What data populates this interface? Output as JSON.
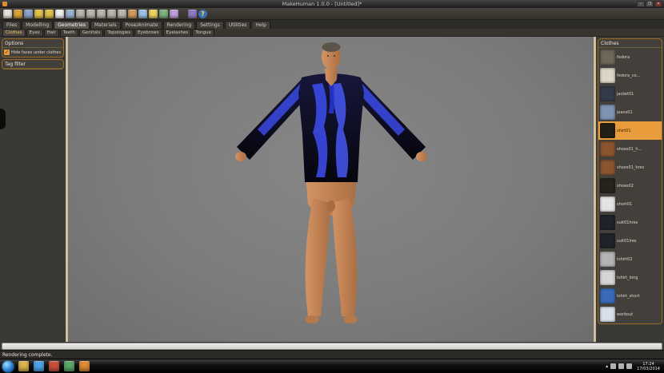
{
  "window": {
    "title": "MakeHuman 1.0.0 - [Untitled]*",
    "controls": {
      "minimize": "–",
      "maximize": "❐",
      "close": "✕"
    }
  },
  "toolbar": {
    "icons": [
      {
        "name": "new-file",
        "color": "#e6e3dd"
      },
      {
        "name": "load",
        "color": "#d8a038"
      },
      {
        "name": "save",
        "color": "#8aa0c8"
      },
      {
        "name": "undo",
        "color": "#e0c048"
      },
      {
        "name": "redo",
        "color": "#e0c048"
      },
      {
        "name": "random",
        "color": "#efefef"
      },
      {
        "name": "grid",
        "color": "#9ab0d0"
      },
      {
        "name": "front-view",
        "color": "#b8b4ae"
      },
      {
        "name": "back-view",
        "color": "#b8b4ae"
      },
      {
        "name": "left-view",
        "color": "#b8b4ae"
      },
      {
        "name": "right-view",
        "color": "#b8b4ae"
      },
      {
        "name": "top-view",
        "color": "#b8b4ae"
      },
      {
        "name": "pose",
        "color": "#cf9a62"
      },
      {
        "name": "smooth",
        "color": "#9cc0e4"
      },
      {
        "name": "light",
        "color": "#ecd25e"
      },
      {
        "name": "material",
        "color": "#7db07d"
      },
      {
        "name": "measure",
        "color": "#c0a0d8"
      },
      {
        "name": "render",
        "color": "#9078c0"
      }
    ],
    "help_glyph": "?"
  },
  "main_tabs": {
    "active": "Geometries",
    "items": [
      {
        "label": "Files"
      },
      {
        "label": "Modelling"
      },
      {
        "label": "Geometries"
      },
      {
        "label": "Materials"
      },
      {
        "label": "Pose/Animate"
      },
      {
        "label": "Rendering"
      },
      {
        "label": "Settings"
      },
      {
        "label": "Utilities"
      },
      {
        "label": "Help"
      }
    ]
  },
  "sub_tabs": {
    "active": "Clothes",
    "items": [
      {
        "label": "Clothes"
      },
      {
        "label": "Eyes"
      },
      {
        "label": "Hair"
      },
      {
        "label": "Teeth"
      },
      {
        "label": "Genitals"
      },
      {
        "label": "Topologies"
      },
      {
        "label": "Eyebrows"
      },
      {
        "label": "Eyelashes"
      },
      {
        "label": "Tongue"
      }
    ]
  },
  "left_panel": {
    "options": {
      "title": "Options",
      "checkbox_label": "Hide faces under clothes",
      "checked": true,
      "check_glyph": "✓"
    },
    "tag_filter": {
      "title": "Tag filter"
    }
  },
  "clothes_panel": {
    "title": "Clothes",
    "selected": "shirt01",
    "items": [
      {
        "label": "fedora",
        "thumb": "#6e6658"
      },
      {
        "label": "fedora_co...",
        "thumb": "#ddd6c8"
      },
      {
        "label": "jacket01",
        "thumb": "#333a4a"
      },
      {
        "label": "jeans01",
        "thumb": "#7e93b4"
      },
      {
        "label": "shirt01",
        "thumb": "#241f16"
      },
      {
        "label": "shoes01_h...",
        "thumb": "#8a5530"
      },
      {
        "label": "shoes01_hres",
        "thumb": "#8a5530"
      },
      {
        "label": "shoes02",
        "thumb": "#28221c"
      },
      {
        "label": "short01",
        "thumb": "#e4e4e4"
      },
      {
        "label": "suit01hres",
        "thumb": "#20222a"
      },
      {
        "label": "suit01lres",
        "thumb": "#20222a"
      },
      {
        "label": "tshirt02",
        "thumb": "#b4b4b4"
      },
      {
        "label": "tshirt_long",
        "thumb": "#d6d6d6"
      },
      {
        "label": "tshirt_short",
        "thumb": "#3a6ab8"
      },
      {
        "label": "workout",
        "thumb": "#d8e0ea"
      }
    ]
  },
  "status": {
    "message": "Rendering complete."
  },
  "taskbar": {
    "icons": [
      {
        "name": "explorer",
        "color": "#d9b44a"
      },
      {
        "name": "internet-explorer",
        "color": "#4aa3e8"
      },
      {
        "name": "media-app",
        "color": "#c8503a"
      },
      {
        "name": "office-app",
        "color": "#58a86a"
      },
      {
        "name": "makehuman",
        "color": "#e08a34"
      }
    ],
    "tray": {
      "expand_glyph": "▴"
    },
    "clock": {
      "time": "17:24",
      "date": "17/03/2014"
    }
  },
  "colors": {
    "accent": "#e89c3c",
    "panel_border": "#9a6a28",
    "viewport_bg": "#7a7a7a"
  }
}
